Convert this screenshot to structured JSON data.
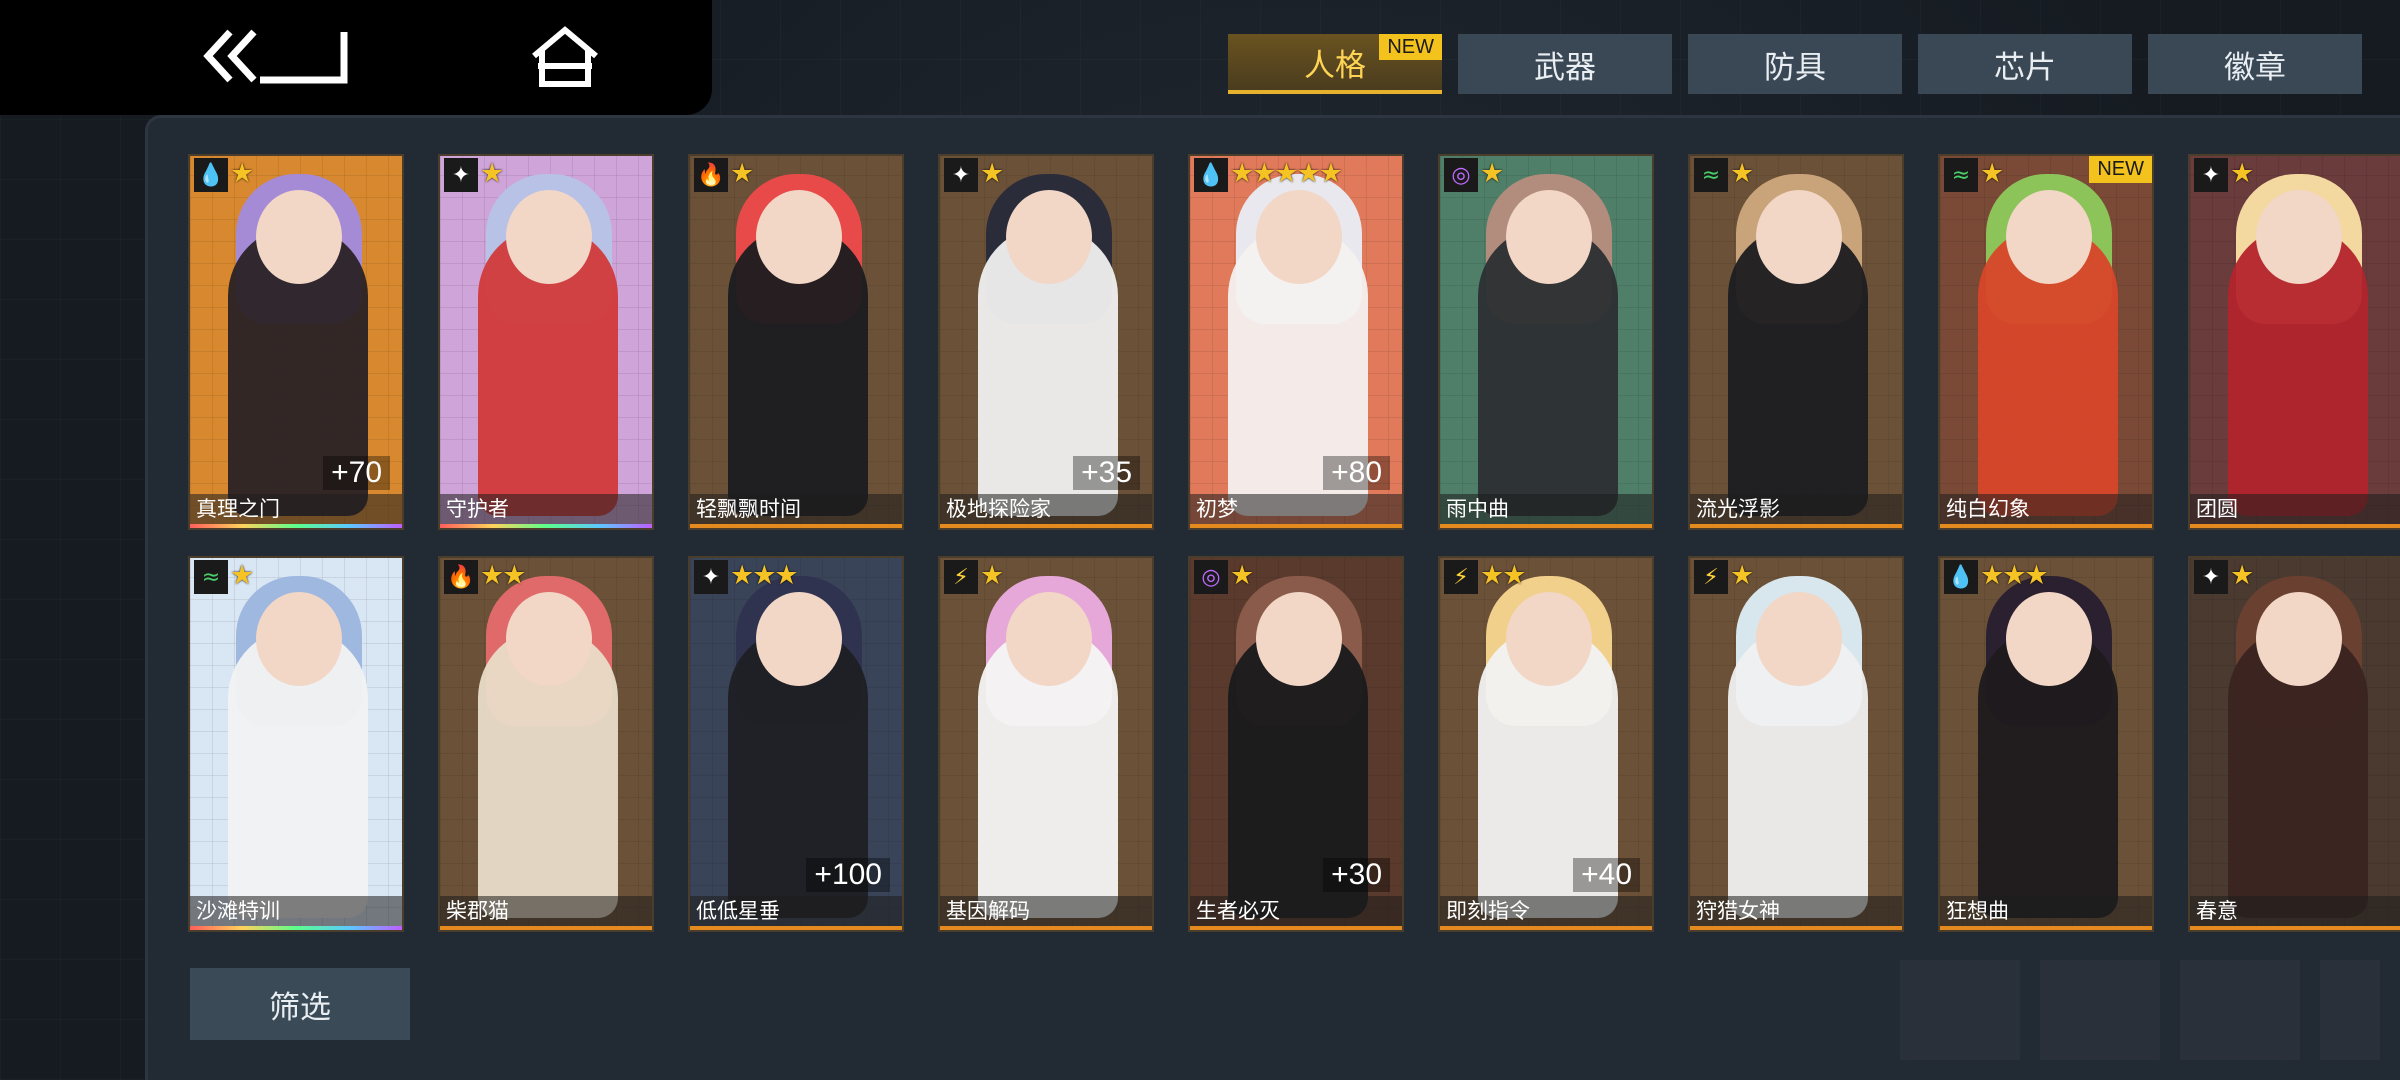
{
  "tabs": [
    {
      "label": "人格",
      "active": true,
      "badge": "NEW"
    },
    {
      "label": "武器",
      "active": false
    },
    {
      "label": "防具",
      "active": false
    },
    {
      "label": "芯片",
      "active": false
    },
    {
      "label": "徽章",
      "active": false
    }
  ],
  "cards": [
    {
      "name": "真理之门",
      "element": "water",
      "stars": 1,
      "plus": "+70",
      "bg": "#d8892f",
      "hair": "#a58ad6",
      "outfit": "#2a2226",
      "rainbow": true
    },
    {
      "name": "守护者",
      "element": "spark",
      "stars": 1,
      "plus": "",
      "bg": "#cfa4d8",
      "hair": "#b8c1e6",
      "outfit": "#d13a3a",
      "rainbow": true
    },
    {
      "name": "轻飘飘时间",
      "element": "fire",
      "stars": 1,
      "plus": "",
      "bg": "#6b5138",
      "hair": "#e84a4a",
      "outfit": "#1b1b1f",
      "rainbow": false
    },
    {
      "name": "极地探险家",
      "element": "spark",
      "stars": 1,
      "plus": "+35",
      "bg": "#6b5138",
      "hair": "#2a2c3a",
      "outfit": "#f0f0f0",
      "rainbow": false
    },
    {
      "name": "初梦",
      "element": "water",
      "stars": 5,
      "plus": "+80",
      "bg": "#e07a5a",
      "hair": "#e8e8ee",
      "outfit": "#f4f1f0",
      "rainbow": false
    },
    {
      "name": "雨中曲",
      "element": "psy",
      "stars": 1,
      "plus": "",
      "bg": "#4f7f68",
      "hair": "#b28c7c",
      "outfit": "#2c2f33",
      "rainbow": false
    },
    {
      "name": "流光浮影",
      "element": "wind",
      "stars": 1,
      "plus": "",
      "bg": "#6b5138",
      "hair": "#c9a47a",
      "outfit": "#1c1c20",
      "rainbow": false
    },
    {
      "name": "纯白幻象",
      "element": "wind",
      "stars": 1,
      "plus": "",
      "bg": "#7a4a36",
      "hair": "#8cc45a",
      "outfit": "#d8462a",
      "rainbow": false,
      "new": "NEW"
    },
    {
      "name": "团圆",
      "element": "spark",
      "stars": 1,
      "plus": "",
      "bg": "#6a3c3c",
      "hair": "#f3d8a0",
      "outfit": "#b3242c",
      "rainbow": false
    },
    {
      "name": "沙滩特训",
      "element": "wind",
      "stars": 1,
      "plus": "",
      "bg": "#d9e6f3",
      "hair": "#9fb8e0",
      "outfit": "#f2f2f2",
      "rainbow": true
    },
    {
      "name": "柴郡猫",
      "element": "fire",
      "stars": 2,
      "plus": "",
      "bg": "#6b5138",
      "hair": "#e06a6a",
      "outfit": "#e9dcc8",
      "rainbow": false
    },
    {
      "name": "低低星垂",
      "element": "spark",
      "stars": 3,
      "plus": "+100",
      "bg": "#3a4458",
      "hair": "#2f3350",
      "outfit": "#1e2024",
      "rainbow": false
    },
    {
      "name": "基因解码",
      "element": "volt",
      "stars": 1,
      "plus": "",
      "bg": "#6b5138",
      "hair": "#e6a8d8",
      "outfit": "#f5f5f5",
      "rainbow": false
    },
    {
      "name": "生者必灭",
      "element": "psy",
      "stars": 1,
      "plus": "+30",
      "bg": "#5a3a2c",
      "hair": "#8a5a4a",
      "outfit": "#1a1a1c",
      "rainbow": false
    },
    {
      "name": "即刻指令",
      "element": "volt",
      "stars": 2,
      "plus": "+40",
      "bg": "#6b5138",
      "hair": "#f0d08a",
      "outfit": "#f2f2f2",
      "rainbow": false
    },
    {
      "name": "狩猎女神",
      "element": "volt",
      "stars": 1,
      "plus": "",
      "bg": "#6b5138",
      "hair": "#d8e6ee",
      "outfit": "#f0f0f0",
      "rainbow": false
    },
    {
      "name": "狂想曲",
      "element": "water",
      "stars": 3,
      "plus": "",
      "bg": "#6b5138",
      "hair": "#2a2030",
      "outfit": "#1e1a1c",
      "rainbow": false
    },
    {
      "name": "春意",
      "element": "spark",
      "stars": 1,
      "plus": "",
      "bg": "#4a3a30",
      "hair": "#6a4030",
      "outfit": "#3a2420",
      "rainbow": false
    }
  ],
  "filter_label": "筛选",
  "colors": {
    "accent": "#f3c21d",
    "tab_bg": "#3a4754",
    "rarity_bar": "#e58a1f"
  }
}
